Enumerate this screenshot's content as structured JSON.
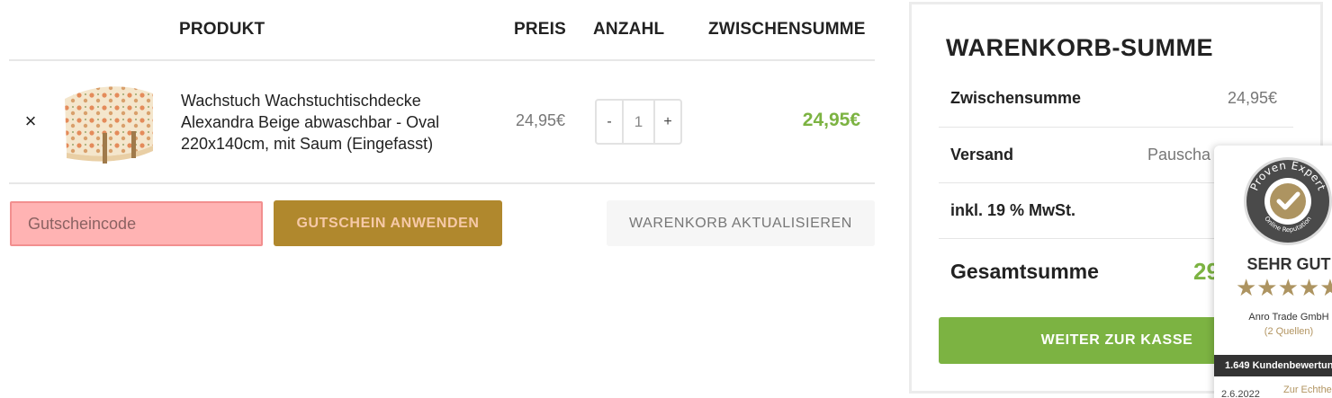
{
  "table": {
    "headers": {
      "product": "PRODUKT",
      "price": "PREIS",
      "quantity": "ANZAHL",
      "subtotal": "ZWISCHENSUMME"
    },
    "row": {
      "remove_icon": "×",
      "name": "Wachstuch Wachstuchtischdecke Alexandra Beige abwaschbar - Oval 220x140cm, mit Saum (Eingefasst)",
      "price": "24,95€",
      "qty_minus": "-",
      "quantity": "1",
      "qty_plus": "+",
      "subtotal": "24,95€"
    }
  },
  "coupon": {
    "placeholder": "Gutscheincode",
    "apply_label": "GUTSCHEIN ANWENDEN",
    "update_label": "WARENKORB AKTUALISIEREN"
  },
  "totals": {
    "title": "WARENKORB-SUMME",
    "subtotal_label": "Zwischensumme",
    "subtotal_value": "24,95€",
    "shipping_label": "Versand",
    "shipping_value": "Pauscha",
    "tax_label": "inkl. 19 % MwSt.",
    "total_label": "Gesamtsumme",
    "total_value": "29",
    "checkout_label": "WEITER ZUR KASSE"
  },
  "proven_expert": {
    "seal_top": "Proven Expert",
    "seal_bottom": "Online Reputation",
    "rating_label": "SEHR GUT",
    "stars": "★★★★★",
    "company": "Anro Trade GmbH",
    "sources": "(2 Quellen)",
    "reviews_bar": "1.649 Kundenbewertun",
    "date": "2.6.2022",
    "authenticity_link": "Zur Echthe"
  },
  "colors": {
    "accent_green": "#7cb342",
    "coupon_button": "#b0882d",
    "coupon_field": "#ffb3b3",
    "seal_gold": "#ad9461"
  }
}
